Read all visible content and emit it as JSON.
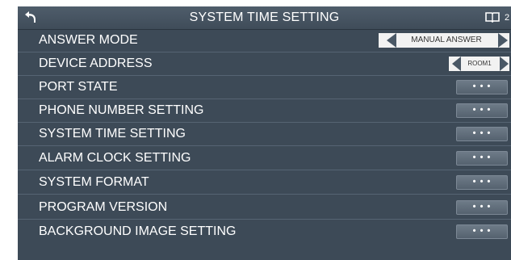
{
  "header": {
    "title": "SYSTEM TIME SETTING",
    "page_indicator": "2"
  },
  "rows": [
    {
      "label": "ANSWER MODE",
      "control": "selector",
      "value": "MANUAL ANSWER"
    },
    {
      "label": "DEVICE ADDRESS",
      "control": "selector",
      "value": "ROOM1"
    },
    {
      "label": "PORT STATE",
      "control": "more",
      "button": "• • •"
    },
    {
      "label": "PHONE NUMBER SETTING",
      "control": "more",
      "button": "• • •"
    },
    {
      "label": "SYSTEM TIME SETTING",
      "control": "more",
      "button": "• • •"
    },
    {
      "label": "ALARM CLOCK SETTING",
      "control": "more",
      "button": "• • •"
    },
    {
      "label": "SYSTEM FORMAT",
      "control": "more",
      "button": "• • •"
    },
    {
      "label": "PROGRAM VERSION",
      "control": "more",
      "button": "• • •"
    },
    {
      "label": "BACKGROUND IMAGE SETTING",
      "control": "more",
      "button": "• • •"
    }
  ],
  "icons": {
    "back": "back-arrow-icon",
    "book": "book-icon",
    "prev": "triangle-left-icon",
    "next": "triangle-right-icon"
  },
  "colors": {
    "panel": "#3d4a57",
    "header": "#4f5d6b",
    "selector": "#f2f2f2"
  }
}
